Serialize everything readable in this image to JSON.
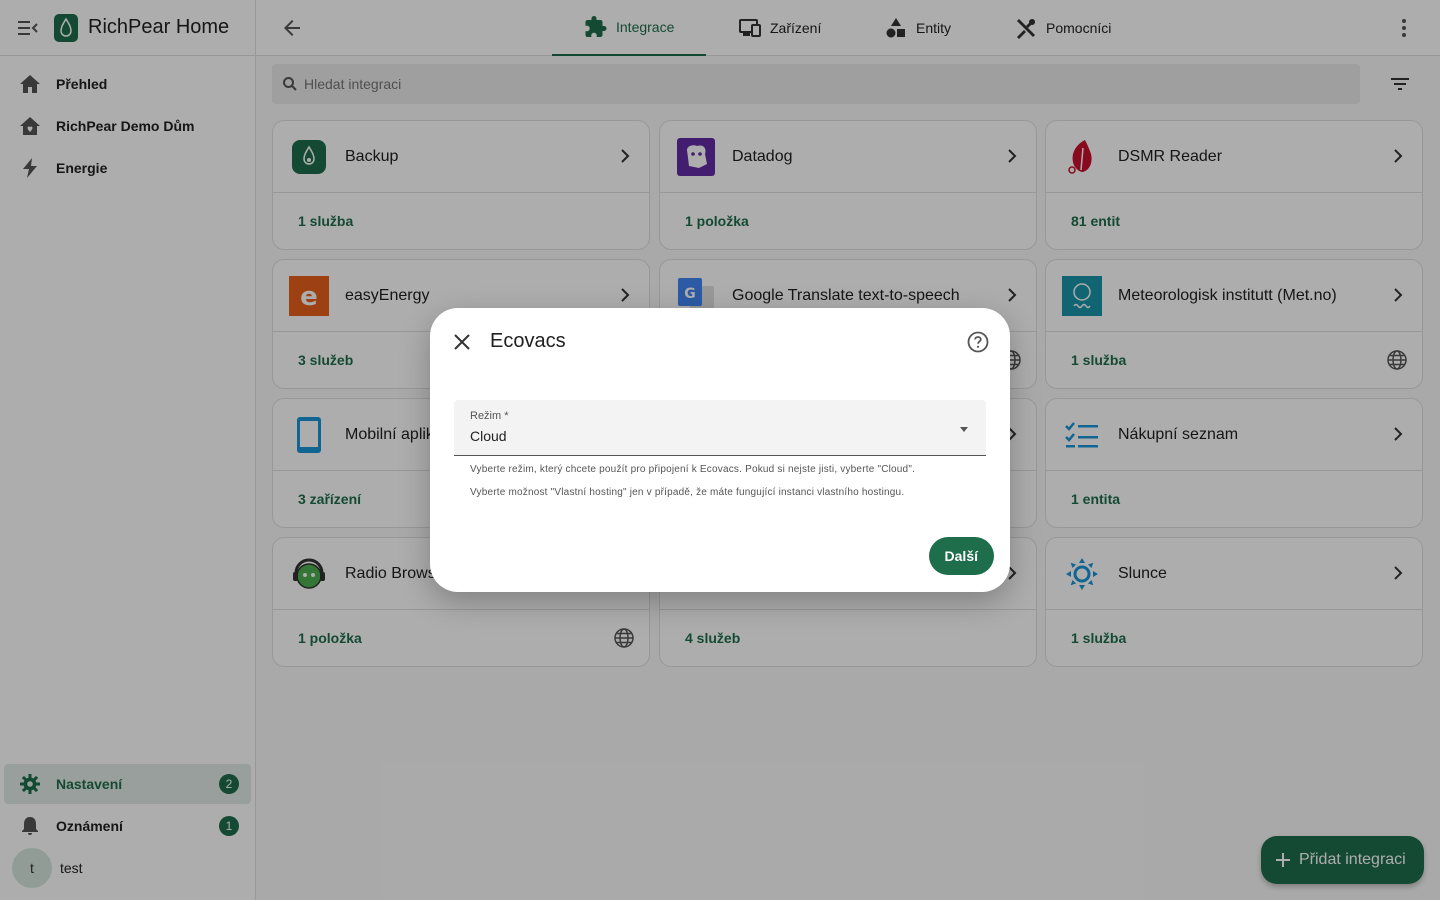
{
  "app": {
    "title": "RichPear Home"
  },
  "sidebar": {
    "items": [
      {
        "label": "Přehled",
        "icon": "home-icon"
      },
      {
        "label": "RichPear Demo Dům",
        "icon": "home-heart-icon"
      },
      {
        "label": "Energie",
        "icon": "lightning-icon"
      }
    ],
    "bottom": {
      "settings": {
        "label": "Nastavení",
        "badge": "2"
      },
      "notifications": {
        "label": "Oznámení",
        "badge": "1"
      },
      "user": {
        "initial": "t",
        "name": "test"
      }
    }
  },
  "tabs": [
    {
      "label": "Integrace",
      "active": true
    },
    {
      "label": "Zařízení",
      "active": false
    },
    {
      "label": "Entity",
      "active": false
    },
    {
      "label": "Pomocníci",
      "active": false
    }
  ],
  "search": {
    "placeholder": "Hledat integraci"
  },
  "cards": [
    {
      "name": "Backup",
      "count": "1 služba"
    },
    {
      "name": "Datadog",
      "count": "1 položka"
    },
    {
      "name": "DSMR Reader",
      "count": "81 entit"
    },
    {
      "name": "easyEnergy",
      "count": "3 služeb"
    },
    {
      "name": "Google Translate text-to-speech",
      "count": ""
    },
    {
      "name": "Meteorologisk institutt (Met.no)",
      "count": "1 služba"
    },
    {
      "name": "Mobilní aplik",
      "count": "3 zařízení"
    },
    {
      "name": "",
      "count": ""
    },
    {
      "name": "Nákupní seznam",
      "count": "1 entita"
    },
    {
      "name": "Radio Brows",
      "count": "1 položka"
    },
    {
      "name": "",
      "count": "4 služeb"
    },
    {
      "name": "Slunce",
      "count": "1 služba"
    }
  ],
  "dialog": {
    "title": "Ecovacs",
    "field_label": "Režim *",
    "field_value": "Cloud",
    "helper_line1": "Vyberte režim, který chcete použít pro připojení k Ecovacs. Pokud si nejste jisti, vyberte \"Cloud\".",
    "helper_line2": "Vyberte možnost \"Vlastní hosting\" jen v případě, že máte fungující instanci vlastního hostingu.",
    "next_label": "Další"
  },
  "fab": {
    "label": "Přidat integraci"
  },
  "colors": {
    "primary": "#1e6e4c",
    "badge": "#1e6e4c"
  }
}
